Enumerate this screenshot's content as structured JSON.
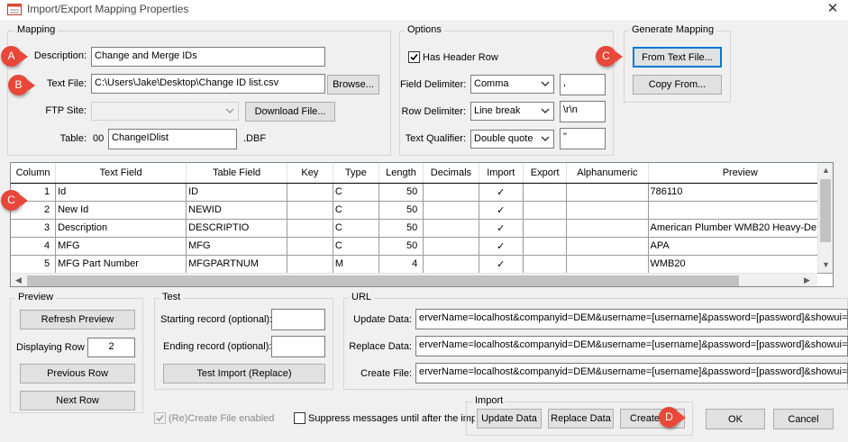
{
  "window": {
    "title": "Import/Export Mapping Properties",
    "close_glyph": "✕"
  },
  "mapping": {
    "group_title": "Mapping",
    "description_label": "Description:",
    "description_value": "Change and Merge IDs",
    "textfile_label": "Text File:",
    "textfile_value": "C:\\Users\\Jake\\Desktop\\Change ID list.csv",
    "browse_label": "Browse...",
    "ftp_label": "FTP Site:",
    "ftp_value": "",
    "download_label": "Download File...",
    "table_label": "Table:",
    "table_prefix": "00",
    "table_value": "ChangeIDlist",
    "table_suffix": ".DBF"
  },
  "options": {
    "group_title": "Options",
    "has_header_label": "Has Header Row",
    "has_header_checked": true,
    "field_delim_label": "Field Delimiter:",
    "field_delim_value": "Comma",
    "field_delim_text": ",",
    "row_delim_label": "Row Delimiter:",
    "row_delim_value": "Line break",
    "row_delim_text": "\\r\\n",
    "text_qual_label": "Text Qualifier:",
    "text_qual_value": "Double quote",
    "text_qual_text": "\""
  },
  "generate": {
    "group_title": "Generate Mapping",
    "from_text_label": "From Text File...",
    "copy_from_label": "Copy From..."
  },
  "grid": {
    "columns": [
      "Column",
      "Text Field",
      "Table Field",
      "Key",
      "Type",
      "Length",
      "Decimals",
      "Import",
      "Export",
      "Alphanumeric",
      "Preview"
    ],
    "rows": [
      {
        "column": "1",
        "text_field": "Id",
        "table_field": "ID",
        "key": "",
        "type": "C",
        "length": "50",
        "decimals": "",
        "import": "✓",
        "export": "",
        "alpha": "",
        "preview": "786110"
      },
      {
        "column": "2",
        "text_field": "New Id",
        "table_field": "NEWID",
        "key": "",
        "type": "C",
        "length": "50",
        "decimals": "",
        "import": "✓",
        "export": "",
        "alpha": "",
        "preview": ""
      },
      {
        "column": "3",
        "text_field": "Description",
        "table_field": "DESCRIPTIO",
        "key": "",
        "type": "C",
        "length": "50",
        "decimals": "",
        "import": "✓",
        "export": "",
        "alpha": "",
        "preview": "American Plumber WMB20 Heavy-De"
      },
      {
        "column": "4",
        "text_field": "MFG",
        "table_field": "MFG",
        "key": "",
        "type": "C",
        "length": "50",
        "decimals": "",
        "import": "✓",
        "export": "",
        "alpha": "",
        "preview": "APA"
      },
      {
        "column": "5",
        "text_field": "MFG Part Number",
        "table_field": "MFGPARTNUM",
        "key": "",
        "type": "M",
        "length": "4",
        "decimals": "",
        "import": "✓",
        "export": "",
        "alpha": "",
        "preview": "WMB20"
      }
    ]
  },
  "preview": {
    "group_title": "Preview",
    "refresh_label": "Refresh Preview",
    "displaying_label": "Displaying Row",
    "displaying_value": "2",
    "prev_label": "Previous Row",
    "next_label": "Next Row"
  },
  "test": {
    "group_title": "Test",
    "start_label": "Starting record (optional):",
    "start_value": "",
    "end_label": "Ending record (optional):",
    "end_value": "",
    "test_import_label": "Test Import (Replace)"
  },
  "url": {
    "group_title": "URL",
    "update_label": "Update Data:",
    "update_value": "erverName=localhost&companyid=DEM&username=[username]&password=[password]&showui=false&",
    "replace_label": "Replace Data:",
    "replace_value": "erverName=localhost&companyid=DEM&username=[username]&password=[password]&showui=false&",
    "create_label": "Create File:",
    "create_value": "erverName=localhost&companyid=DEM&username=[username]&password=[password]&showui=false&"
  },
  "bottom": {
    "recreate_label": "(Re)Create File enabled",
    "suppress_label": "Suppress messages until after the impor",
    "import_group_title": "Import",
    "update_data_label": "Update Data",
    "replace_data_label": "Replace Data",
    "create_label": "Create",
    "ok_label": "OK",
    "cancel_label": "Cancel"
  },
  "markers": {
    "a": "A",
    "b": "B",
    "c1": "C",
    "c2": "C",
    "d": "D"
  },
  "colors": {
    "marker": "#e8473a",
    "accent": "#0078d7"
  }
}
